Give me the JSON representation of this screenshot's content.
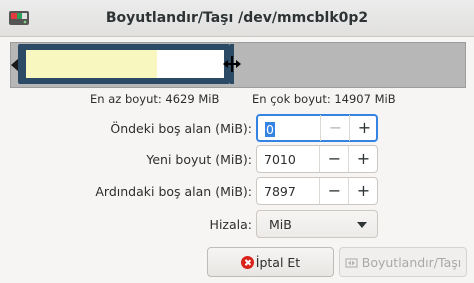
{
  "window": {
    "title": "Boyutlandır/Taşı /dev/mmcblk0p2",
    "icon": "gparted-disk-icon"
  },
  "partition_visual": {
    "used_fraction": 0.66
  },
  "info": {
    "min_size_label": "En az boyut: 4629 MiB",
    "max_size_label": "En çok boyut: 14907 MiB"
  },
  "fields": {
    "free_before": {
      "label": "Öndeki boş alan (MiB):",
      "value": "0"
    },
    "new_size": {
      "label": "Yeni boyut (MiB):",
      "value": "7010"
    },
    "free_after": {
      "label": "Ardındaki boş alan (MiB):",
      "value": "7897"
    },
    "align": {
      "label": "Hizala:",
      "value": "MiB"
    }
  },
  "spin_buttons": {
    "minus": "−",
    "plus": "+"
  },
  "buttons": {
    "cancel_label": "İptal Et",
    "resize_label": "Boyutlandır/Taşı"
  },
  "colors": {
    "focus": "#3584e4",
    "partition_border": "#2b4a66",
    "used": "#f7f7bf"
  }
}
